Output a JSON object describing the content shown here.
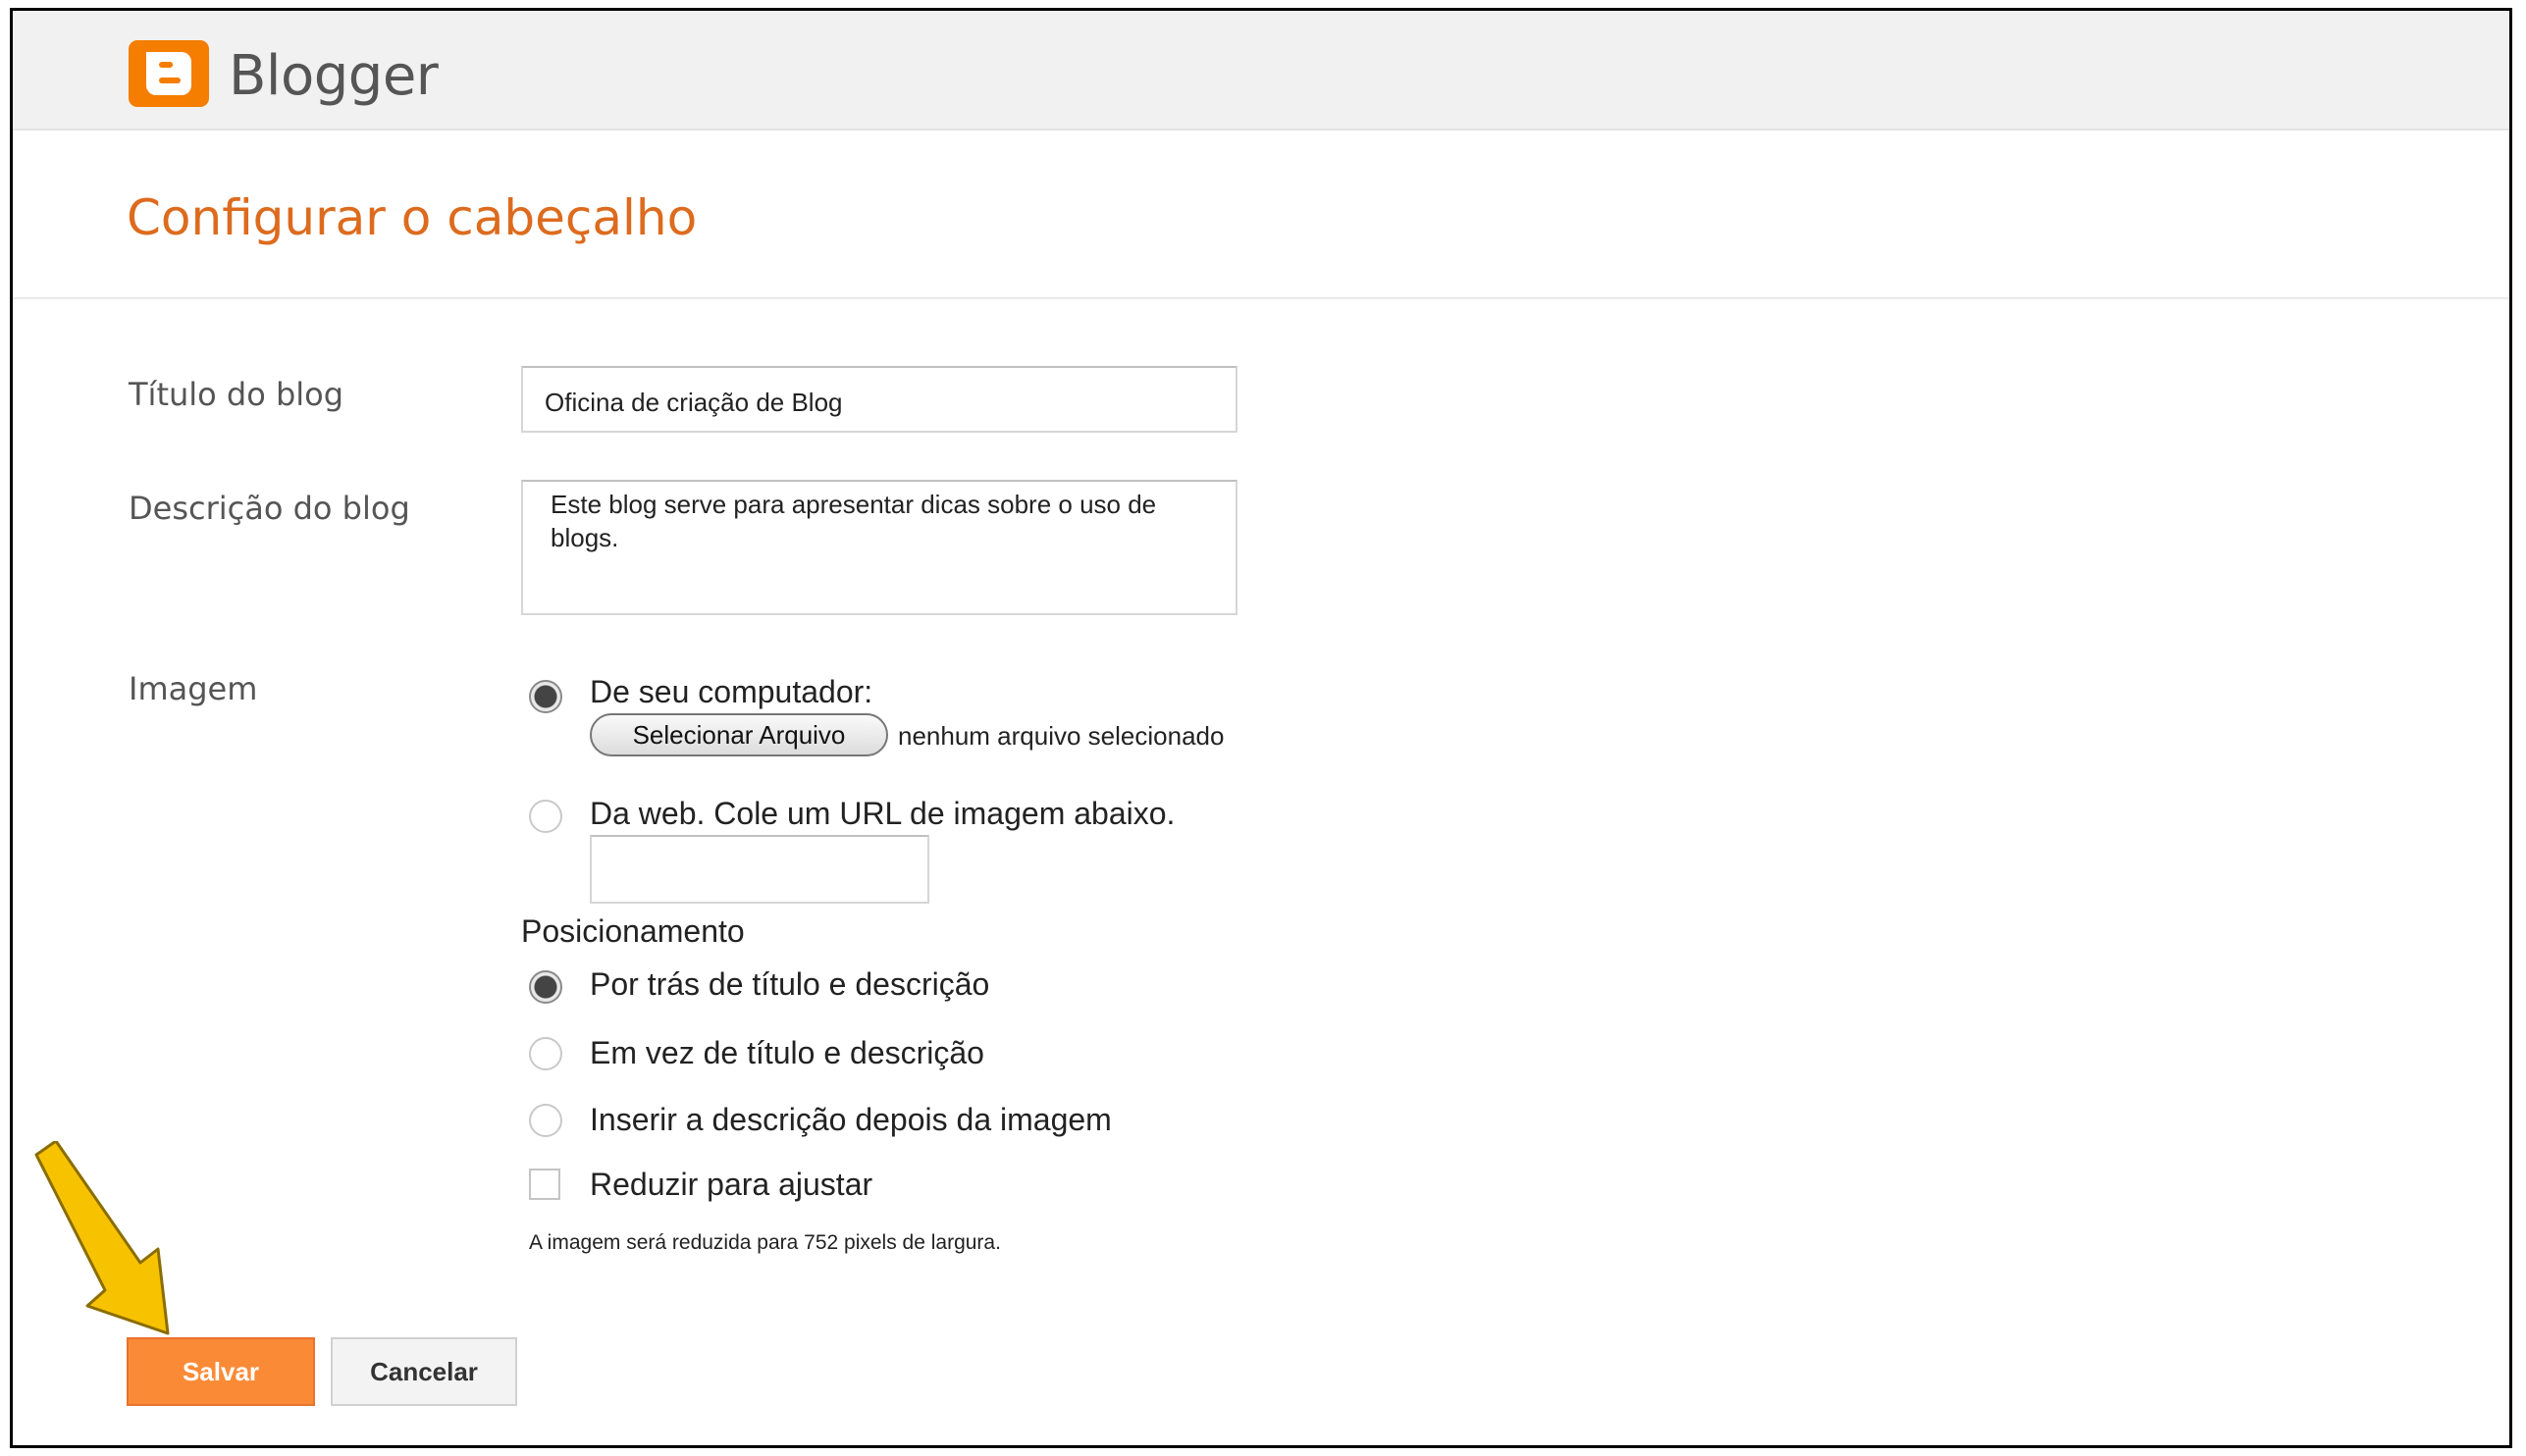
{
  "app": {
    "brand": "Blogger",
    "accent_color": "#f57d00",
    "title_color": "#dd6b1e"
  },
  "page": {
    "title": "Configurar o cabeçalho"
  },
  "form": {
    "blog_title": {
      "label": "Título do blog",
      "value": "Oficina de criação de Blog"
    },
    "blog_description": {
      "label": "Descrição do blog",
      "value": "Este blog serve para apresentar dicas sobre o uso de blogs.",
      "line1": "Este blog serve para apresentar dicas sobre o uso de",
      "line2": "blogs."
    },
    "image": {
      "label": "Imagem",
      "source_options": [
        {
          "label": "De seu computador:",
          "selected": true
        },
        {
          "label": "Da web. Cole um URL de imagem abaixo.",
          "selected": false
        }
      ],
      "file_button_label": "Selecionar Arquivo",
      "file_status": "nenhum arquivo selecionado",
      "url_value": ""
    },
    "positioning": {
      "label": "Posicionamento",
      "options": [
        {
          "label": "Por trás de título e descrição",
          "selected": true
        },
        {
          "label": "Em vez de título e descrição",
          "selected": false
        },
        {
          "label": "Inserir a descrição depois da imagem",
          "selected": false
        }
      ],
      "shrink_label": "Reduzir para ajustar",
      "shrink_checked": false,
      "note": "A imagem será reduzida para 752 pixels de largura."
    }
  },
  "actions": {
    "save_label": "Salvar",
    "cancel_label": "Cancelar",
    "save_color": "#fb8a37"
  },
  "annotation": {
    "arrow_color": "#f7c300",
    "arrow_icon": "arrow-down-right-icon"
  }
}
